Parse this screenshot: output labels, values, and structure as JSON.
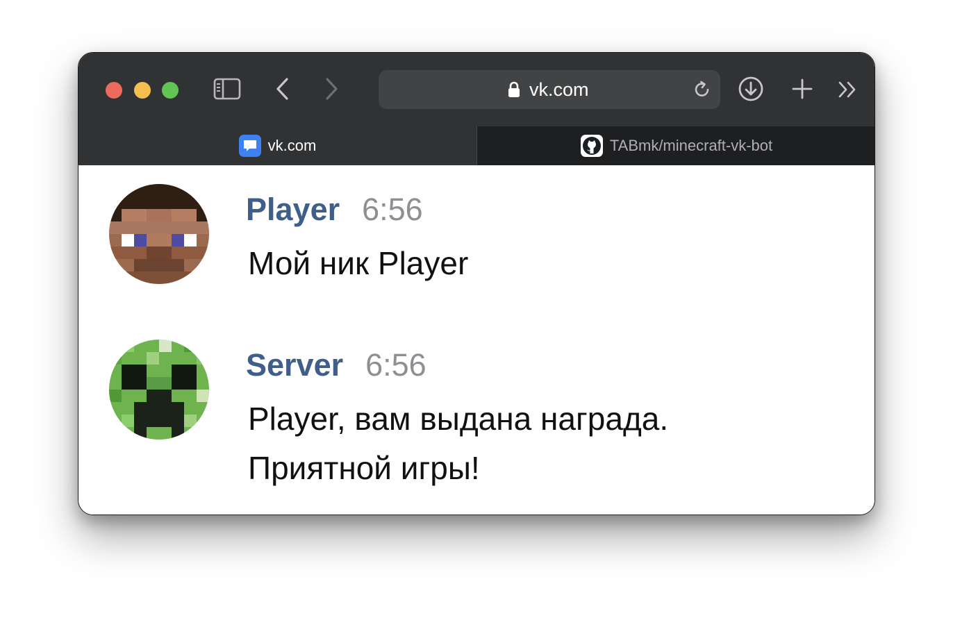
{
  "browser": {
    "address_bar": {
      "url": "vk.com"
    },
    "tabs": [
      {
        "label": "vk.com",
        "favicon": "vk-messenger-icon",
        "active": true
      },
      {
        "label": "TABmk/minecraft-vk-bot",
        "favicon": "github-icon",
        "active": false
      }
    ],
    "colors": {
      "toolbar": "#313234",
      "address_bar": "#424345",
      "inactive_tab": "#1e1f20"
    }
  },
  "chat": {
    "messages": [
      {
        "author": "Player",
        "time": "6:56",
        "avatar": "minecraft-steve-avatar",
        "lines": [
          "Мой ник Player"
        ]
      },
      {
        "author": "Server",
        "time": "6:56",
        "avatar": "minecraft-creeper-avatar",
        "lines": [
          "Player, вам выдана награда.",
          "Приятной игры!"
        ]
      }
    ],
    "colors": {
      "author": "#3f5f8a",
      "time": "#8e8e93",
      "text": "#111111"
    }
  }
}
